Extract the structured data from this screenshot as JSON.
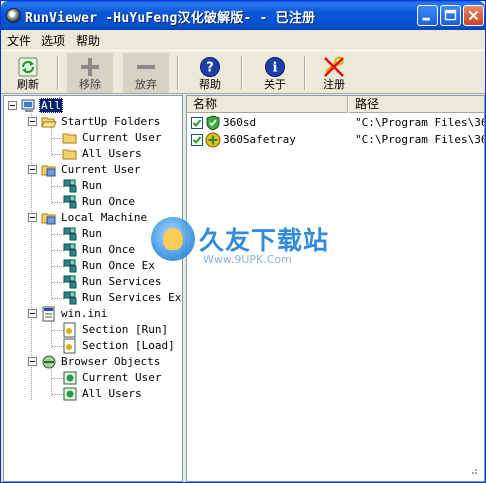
{
  "window": {
    "title": "RunViewer  -HuYuFeng汉化破解版- - 已注册"
  },
  "menu": {
    "file": "文件",
    "options": "选项",
    "help": "帮助"
  },
  "toolbar": {
    "refresh": "刷新",
    "remove": "移除",
    "discard": "放弃",
    "help": "帮助",
    "about": "关于",
    "register": "注册"
  },
  "tree": {
    "root": "All",
    "startup_folders": "StartUp Folders",
    "startup_current_user": "Current User",
    "startup_all_users": "All Users",
    "current_user": "Current User",
    "cu_run": "Run",
    "cu_run_once": "Run Once",
    "local_machine": "Local Machine",
    "lm_run": "Run",
    "lm_run_once": "Run Once",
    "lm_run_once_ex": "Run Once Ex",
    "lm_run_services": "Run Services",
    "lm_run_services_ex": "Run Services Ex",
    "win_ini": "win.ini",
    "section_run": "Section [Run]",
    "section_load": "Section [Load]",
    "browser_objects": "Browser Objects",
    "bo_current_user": "Current User",
    "bo_all_users": "All Users"
  },
  "list": {
    "col_name": "名称",
    "col_path": "路径",
    "rows": [
      {
        "name": "360sd",
        "path": "\"C:\\Program Files\\360\\",
        "checked": true
      },
      {
        "name": "360Safetray",
        "path": "\"C:\\Program Files\\360\\",
        "checked": true
      }
    ]
  },
  "watermark": {
    "title": "久友下载站",
    "url": "Www.9UPK.Com"
  },
  "colors": {
    "titlebar": "#0a57d6",
    "selection": "#0a246a",
    "face": "#ece9d8"
  }
}
